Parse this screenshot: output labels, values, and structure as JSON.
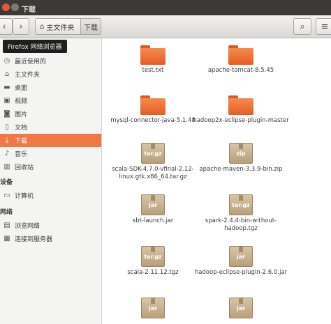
{
  "window": {
    "title": "下载"
  },
  "toolbar": {
    "back_glyph": "‹",
    "forward_glyph": "›",
    "breadcrumb_home": "主文件夹",
    "breadcrumb_current": "下载",
    "search_glyph": "⌕",
    "menu_glyph": "≡"
  },
  "tooltip": {
    "text": "Firefox 网络浏览器"
  },
  "sidebar": {
    "items": [
      {
        "label": "最近使用的",
        "icon": "clock-icon",
        "glyph": "◷"
      },
      {
        "label": "主文件夹",
        "icon": "home-icon",
        "glyph": "⌂"
      },
      {
        "label": "桌面",
        "icon": "desktop-folder-icon",
        "glyph": "▬"
      },
      {
        "label": "视频",
        "icon": "video-icon",
        "glyph": "▣"
      },
      {
        "label": "图片",
        "icon": "camera-icon",
        "glyph": "◙"
      },
      {
        "label": "文档",
        "icon": "document-icon",
        "glyph": "▯"
      },
      {
        "label": "下载",
        "icon": "download-icon",
        "glyph": "⤓"
      },
      {
        "label": "音乐",
        "icon": "music-icon",
        "glyph": "♪"
      },
      {
        "label": "回收站",
        "icon": "trash-icon",
        "glyph": "▥"
      }
    ],
    "devices_header": "设备",
    "devices": [
      {
        "label": "计算机",
        "icon": "computer-icon",
        "glyph": "▭"
      }
    ],
    "network_header": "网络",
    "network": [
      {
        "label": "浏览网络",
        "icon": "network-icon",
        "glyph": "▤"
      },
      {
        "label": "连接到服务器",
        "icon": "server-icon",
        "glyph": "▦"
      }
    ]
  },
  "files": [
    {
      "name": "test.txt",
      "kind": "folder"
    },
    {
      "name": "apache-tomcat-8.5.45",
      "kind": "folder"
    },
    {
      "name": "mysql-connector-java-5.1.48",
      "kind": "folder"
    },
    {
      "name": "hadoop2x-eclipse-plugin-master",
      "kind": "folder"
    },
    {
      "name": "scala-SDK-4.7.0-vfinal-2.12-linux.gtk.x86_64.tar.gz",
      "kind": "archive",
      "ext": "tar.gz"
    },
    {
      "name": "apache-maven-3.3.9-bin.zip",
      "kind": "archive",
      "ext": "zip"
    },
    {
      "name": "sbt-launch.jar",
      "kind": "archive",
      "ext": "jar"
    },
    {
      "name": "spark-2.4.4-bin-without-hadoop.tgz",
      "kind": "archive",
      "ext": "tar.gz"
    },
    {
      "name": "scala-2.11.12.tgz",
      "kind": "archive",
      "ext": "tar.gz"
    },
    {
      "name": "hadoop-eclipse-plugin-2.6.0.jar",
      "kind": "archive",
      "ext": "jar"
    },
    {
      "name": "",
      "kind": "archive",
      "ext": "jar"
    },
    {
      "name": "",
      "kind": "archive",
      "ext": "jar"
    }
  ]
}
